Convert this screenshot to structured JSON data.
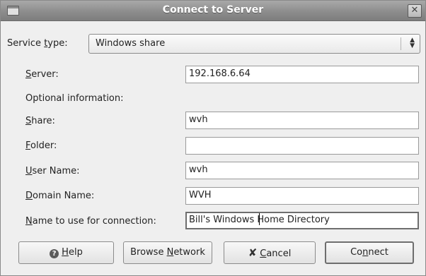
{
  "window": {
    "title": "Connect to Server"
  },
  "service_type": {
    "label_pre": "Service ",
    "label_key": "t",
    "label_post": "ype:",
    "value": "Windows share"
  },
  "server": {
    "label_key": "S",
    "label_rest": "erver:",
    "value": "192.168.6.64"
  },
  "optional_heading": "Optional information:",
  "share": {
    "label_key": "S",
    "label_rest": "hare:",
    "value": "wvh"
  },
  "folder": {
    "label_key": "F",
    "label_rest": "older:",
    "value": ""
  },
  "user_name": {
    "label_key": "U",
    "label_rest": "ser Name:",
    "value": "wvh"
  },
  "domain_name": {
    "label_key": "D",
    "label_rest": "omain Name:",
    "value": "WVH"
  },
  "connection_name": {
    "label_key": "N",
    "label_rest": "ame to use for connection:",
    "value": "Bill's Windows Home Directory"
  },
  "buttons": {
    "help": {
      "key": "H",
      "rest": "elp"
    },
    "browse": {
      "pre": "Browse ",
      "key": "N",
      "rest": "etwork"
    },
    "cancel": {
      "key": "C",
      "rest": "ancel"
    },
    "connect": {
      "pre": "Co",
      "key": "n",
      "rest": "nect"
    }
  },
  "icons": {
    "help": "help-icon",
    "cancel": "cancel-icon",
    "close": "close-icon",
    "window": "window-icon"
  }
}
